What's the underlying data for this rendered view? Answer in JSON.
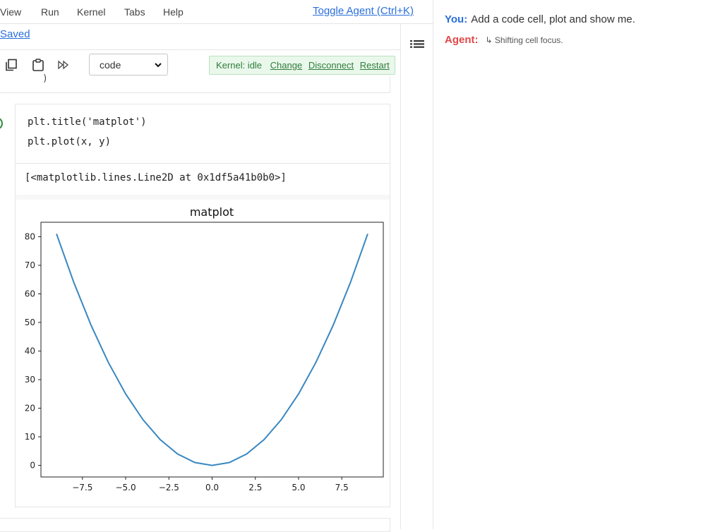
{
  "menu": {
    "items": [
      {
        "label": "View"
      },
      {
        "label": "Run"
      },
      {
        "label": "Kernel"
      },
      {
        "label": "Tabs"
      },
      {
        "label": "Help"
      }
    ],
    "toggle_agent": "Toggle Agent (Ctrl+K)"
  },
  "header": {
    "saved": "Saved"
  },
  "toolbar": {
    "cell_type": "code",
    "kernel_status": "Kernel: idle",
    "change": "Change",
    "disconnect": "Disconnect",
    "restart": "Restart"
  },
  "cell": {
    "code_lines": [
      "plt.title('matplot')",
      "plt.plot(x, y)"
    ],
    "output_text": "[<matplotlib.lines.Line2D at 0x1df5a41b0b0>]",
    "prev_fragment": "  )"
  },
  "chat": {
    "you_label": "You:",
    "you_text": "Add a code cell, plot and show me.",
    "agent_label": "Agent:",
    "agent_status": "↳ Shifting cell focus."
  },
  "colors": {
    "accent_link": "#2a6fdb",
    "agent_red": "#e04848",
    "kernel_green": "#2f7d3a",
    "line_blue": "#3a87c0"
  },
  "chart_data": {
    "type": "line",
    "title": "matplot",
    "xlabel": "",
    "ylabel": "",
    "x": [
      -9,
      -8,
      -7,
      -6,
      -5,
      -4,
      -3,
      -2,
      -1,
      0,
      1,
      2,
      3,
      4,
      5,
      6,
      7,
      8,
      9
    ],
    "series": [
      {
        "values": [
          81,
          64,
          49,
          36,
          25,
          16,
          9,
          4,
          1,
          0,
          1,
          4,
          9,
          16,
          25,
          36,
          49,
          64,
          81
        ]
      }
    ],
    "xlim": [
      -9.9,
      9.9
    ],
    "ylim": [
      -4.05,
      85.05
    ],
    "xticks": [
      -7.5,
      -5.0,
      -2.5,
      0.0,
      2.5,
      5.0,
      7.5
    ],
    "xtick_labels": [
      "−7.5",
      "−5.0",
      "−2.5",
      "0.0",
      "2.5",
      "5.0",
      "7.5"
    ],
    "yticks": [
      0,
      10,
      20,
      30,
      40,
      50,
      60,
      70,
      80
    ],
    "ytick_labels": [
      "0",
      "10",
      "20",
      "30",
      "40",
      "50",
      "60",
      "70",
      "80"
    ],
    "grid": false,
    "legend": "none"
  }
}
